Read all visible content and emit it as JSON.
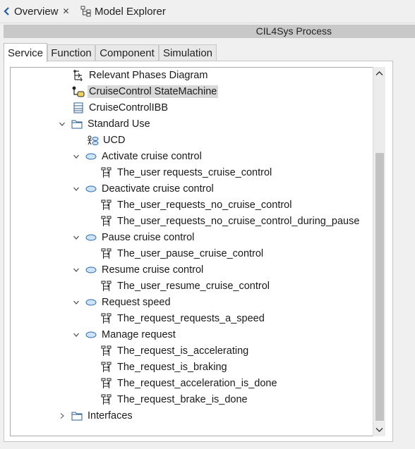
{
  "view_tabs": {
    "overview_label": "Overview",
    "model_explorer_label": "Model Explorer"
  },
  "title_bar": {
    "title": "CIL4Sys Process"
  },
  "inner_tabs": [
    {
      "label": "Service",
      "active": true
    },
    {
      "label": "Function",
      "active": false
    },
    {
      "label": "Component",
      "active": false
    },
    {
      "label": "Simulation",
      "active": false
    }
  ],
  "tree": {
    "items": [
      {
        "label": "Relevant Phases Diagram",
        "icon": "phases-diagram-icon",
        "expanded": null,
        "selected": false
      },
      {
        "label": "CruiseControl StateMachine",
        "icon": "state-machine-icon",
        "expanded": null,
        "selected": true
      },
      {
        "label": "CruiseControlIBB",
        "icon": "ibb-icon",
        "expanded": null,
        "selected": false
      },
      {
        "label": "Standard Use",
        "icon": "folder-icon",
        "expanded": true,
        "selected": false
      },
      {
        "label": "UCD",
        "icon": "use-case-diagram-icon",
        "expanded": null,
        "selected": false
      },
      {
        "label": "Activate cruise control",
        "icon": "use-case-icon",
        "expanded": true,
        "selected": false
      },
      {
        "label": "The_user requests_cruise_control",
        "icon": "scenario-icon",
        "expanded": null,
        "selected": false
      },
      {
        "label": "Deactivate cruise control",
        "icon": "use-case-icon",
        "expanded": true,
        "selected": false
      },
      {
        "label": "The_user_requests_no_cruise_control",
        "icon": "scenario-icon",
        "expanded": null,
        "selected": false
      },
      {
        "label": "The_user_requests_no_cruise_control_during_pause",
        "icon": "scenario-icon",
        "expanded": null,
        "selected": false
      },
      {
        "label": "Pause cruise control",
        "icon": "use-case-icon",
        "expanded": true,
        "selected": false
      },
      {
        "label": "The_user_pause_cruise_control",
        "icon": "scenario-icon",
        "expanded": null,
        "selected": false
      },
      {
        "label": "Resume cruise control",
        "icon": "use-case-icon",
        "expanded": true,
        "selected": false
      },
      {
        "label": "The_user_resume_cruise_control",
        "icon": "scenario-icon",
        "expanded": null,
        "selected": false
      },
      {
        "label": "Request speed",
        "icon": "use-case-icon",
        "expanded": true,
        "selected": false
      },
      {
        "label": "The_request_requests_a_speed",
        "icon": "scenario-icon",
        "expanded": null,
        "selected": false
      },
      {
        "label": "Manage request",
        "icon": "use-case-icon",
        "expanded": true,
        "selected": false
      },
      {
        "label": "The_request_is_accelerating",
        "icon": "scenario-icon",
        "expanded": null,
        "selected": false
      },
      {
        "label": "The_request_is_braking",
        "icon": "scenario-icon",
        "expanded": null,
        "selected": false
      },
      {
        "label": "The_request_acceleration_is_done",
        "icon": "scenario-icon",
        "expanded": null,
        "selected": false
      },
      {
        "label": "The_request_brake_is_done",
        "icon": "scenario-icon",
        "expanded": null,
        "selected": false
      },
      {
        "label": "Interfaces",
        "icon": "folder-icon",
        "expanded": false,
        "selected": false
      }
    ]
  },
  "colors": {
    "selection": "#d9d9d9",
    "title_bar": "#c8c8c8",
    "use_case_fill": "#cfe3f7",
    "use_case_stroke": "#2b6cb0",
    "folder_stroke": "#2d5f8f"
  }
}
